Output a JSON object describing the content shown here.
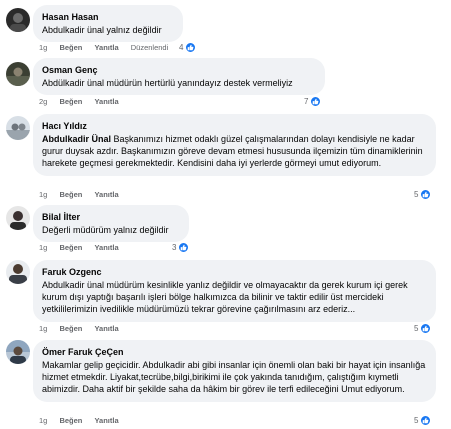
{
  "actions": {
    "like_label": "Beğen",
    "reply_label": "Yanıtla",
    "edited_label": "Düzenlendi"
  },
  "comments": [
    {
      "author": "Hasan Hasan",
      "text": "Abdulkadir ünal yalnız değildir",
      "time": "1g",
      "reactions": "4",
      "edited": true
    },
    {
      "author": "Osman Genç",
      "text": "Abdülkadir ünal müdürün hertürlü yanındayız destek vermeliyiz",
      "time": "2g",
      "reactions": "7",
      "edited": false
    },
    {
      "author": "Hacı Yıldız",
      "mention": "Abdulkadir Ünal",
      "text": " Başkanımızı hizmet odaklı güzel çalışmalarından dolayı kendisiyle ne kadar gurur duysak azdır. Başkanımızın göreve devam etmesi hususunda ilçemizin tüm dinamiklerinin harekete geçmesi gerekmektedir. Kendisini daha iyi yerlerde görmeyi umut ediyorum.",
      "time": "1g",
      "reactions": "5",
      "edited": false
    },
    {
      "author": "Bilal İlter",
      "text": "Değerli müdürüm yalnız değildir",
      "time": "1g",
      "reactions": "3",
      "edited": false
    },
    {
      "author": "Faruk Ozgenc",
      "text": "Abdulkadir ünal müdürüm kesinlikle yanlız değildir ve olmayacaktır da gerek kurum içi gerek kurum dışı yaptığı başarılı işleri bölge halkımızca da bilinir ve taktir edilir üst mercideki yetkililerimizin ivedilikle müdürümüzü tekrar görevine çağırılmasını arz ederiz...",
      "time": "1g",
      "reactions": "5",
      "edited": false
    },
    {
      "author": "Ömer Faruk ÇeÇen",
      "text": "Makamlar gelip geçicidir. Abdulkadir abi gibi insanlar için önemli olan baki bir hayat için insanlığa hizmet etmekdir. Liyakat,tecrübe,bilgi,birikimi ile çok yakında tanıdığım, çalıştığım kıymetli abimizdir. Daha aktif bir şekilde saha da hâkim bir görev ile terfi edileceğini Umut ediyorum.",
      "time": "1g",
      "reactions": "5",
      "edited": false
    }
  ]
}
